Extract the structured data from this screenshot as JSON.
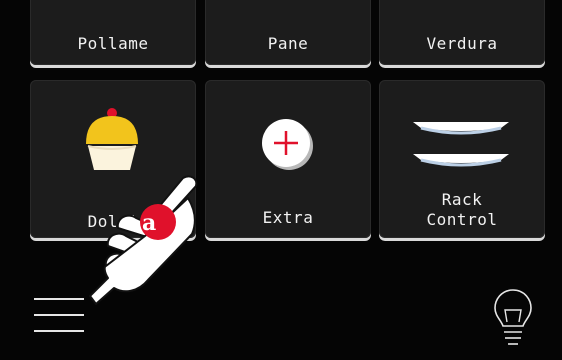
{
  "grid": {
    "row1": [
      {
        "label": "Pollame"
      },
      {
        "label": "Pane"
      },
      {
        "label": "Verdura"
      }
    ],
    "row2": [
      {
        "label": "Dolci",
        "icon": "cupcake-icon"
      },
      {
        "label": "Extra",
        "icon": "plus-icon"
      },
      {
        "label": "Rack\nControl",
        "icon": "rack-trays-icon"
      }
    ]
  },
  "bottom_bar": {
    "menu_icon": "hamburger-menu-icon",
    "light_icon": "light-bulb-icon"
  },
  "overlay": {
    "pointer_icon": "pointing-hand-icon",
    "badge_letter": "a"
  },
  "colors": {
    "background": "#000000",
    "tile": "#1c1c1c",
    "accent_red": "#e0112b",
    "cupcake_yellow": "#f2c41c"
  }
}
